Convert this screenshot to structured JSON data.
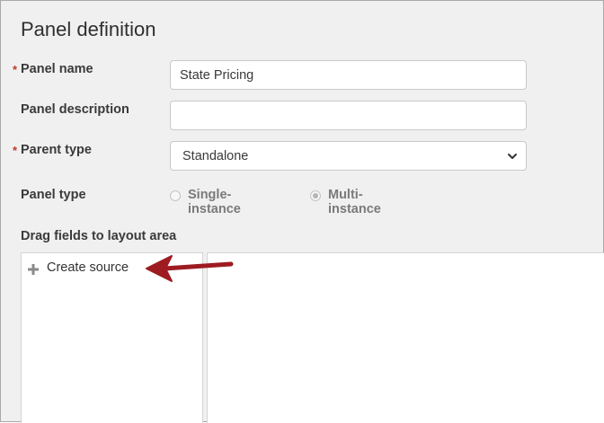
{
  "title": "Panel definition",
  "required_marker": "*",
  "fields": {
    "panel_name": {
      "label": "Panel name",
      "value": "State Pricing"
    },
    "panel_description": {
      "label": "Panel description",
      "value": ""
    },
    "parent_type": {
      "label": "Parent type",
      "value": "Standalone"
    }
  },
  "panel_type": {
    "label": "Panel type",
    "options": [
      "Single-instance",
      "Multi-instance"
    ],
    "selected": "Multi-instance"
  },
  "layout": {
    "label": "Drag fields to layout area",
    "create_source_label": "Create source"
  },
  "colors": {
    "required": "#c0392b",
    "annotation_arrow": "#9e1b22"
  },
  "icons": [
    "chevron-down-icon",
    "plus-icon",
    "annotation-arrow"
  ]
}
